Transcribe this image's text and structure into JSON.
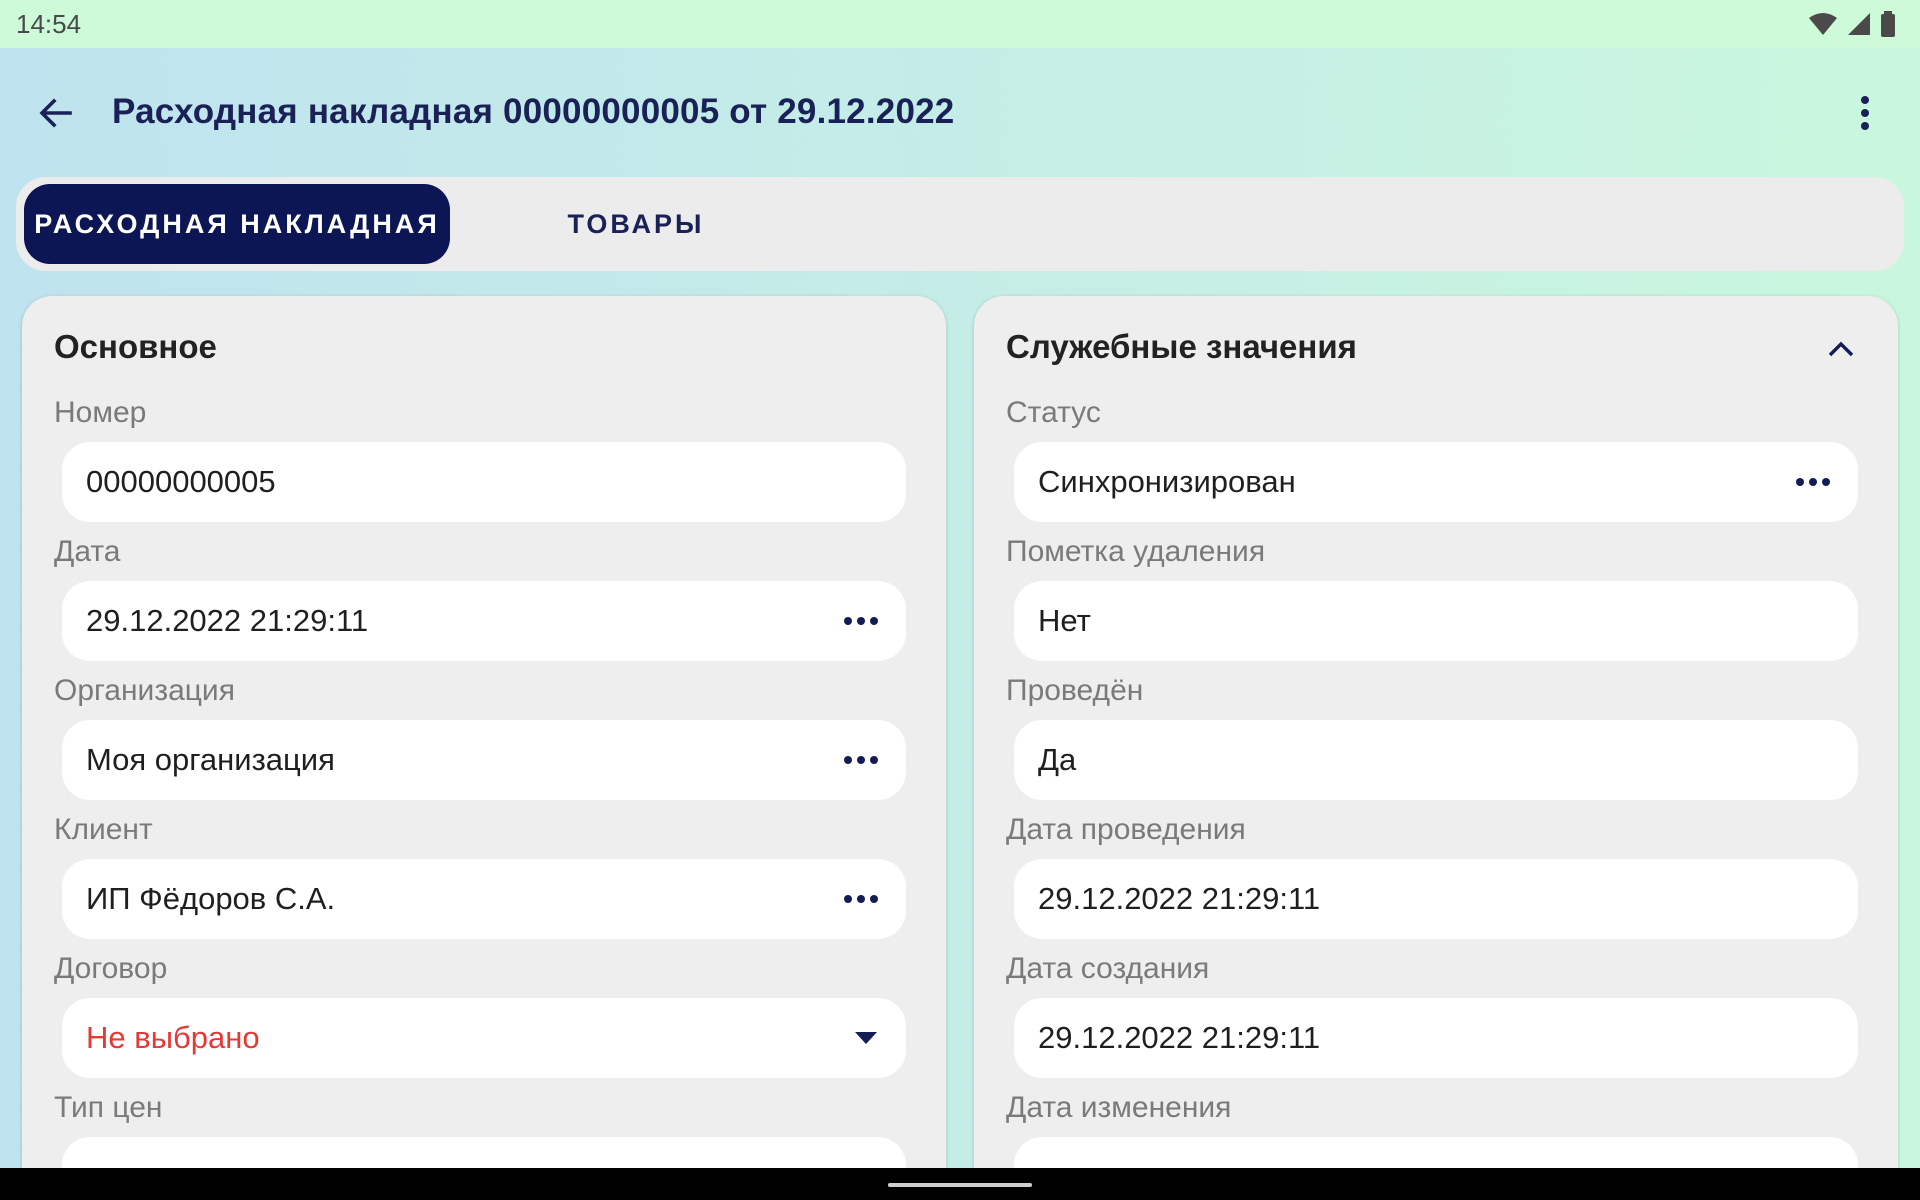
{
  "status_bar": {
    "time": "14:54",
    "icons": [
      "wifi-icon",
      "signal-icon",
      "battery-icon"
    ]
  },
  "app_bar": {
    "title": "Расходная накладная 00000000005 от 29.12.2022",
    "back_icon": "arrow-back-icon",
    "menu_icon": "more-vert-icon"
  },
  "tabs": [
    {
      "label": "РАСХОДНАЯ НАКЛАДНАЯ",
      "active": true
    },
    {
      "label": "ТОВАРЫ",
      "active": false
    }
  ],
  "main_section": {
    "title": "Основное",
    "fields": [
      {
        "label": "Номер",
        "value": "00000000005"
      },
      {
        "label": "Дата",
        "value": "29.12.2022 21:29:11"
      },
      {
        "label": "Организация",
        "value": "Моя организация"
      },
      {
        "label": "Клиент",
        "value": "ИП Фёдоров С.А."
      },
      {
        "label": "Договор",
        "value": "Не выбрано"
      },
      {
        "label": "Тип цен"
      }
    ]
  },
  "service_section": {
    "title": "Служебные значения",
    "fields": [
      {
        "label": "Статус",
        "value": "Синхронизирован"
      },
      {
        "label": "Пометка удаления",
        "value": "Нет"
      },
      {
        "label": "Проведён",
        "value": "Да"
      },
      {
        "label": "Дата проведения",
        "value": "29.12.2022 21:29:11"
      },
      {
        "label": "Дата создания",
        "value": "29.12.2022 21:29:11"
      },
      {
        "label": "Дата изменения"
      }
    ]
  },
  "colors": {
    "primary": "#0d1655",
    "title": "#1a2156",
    "error": "#e53935",
    "status_bar": "#cdfbd9"
  }
}
